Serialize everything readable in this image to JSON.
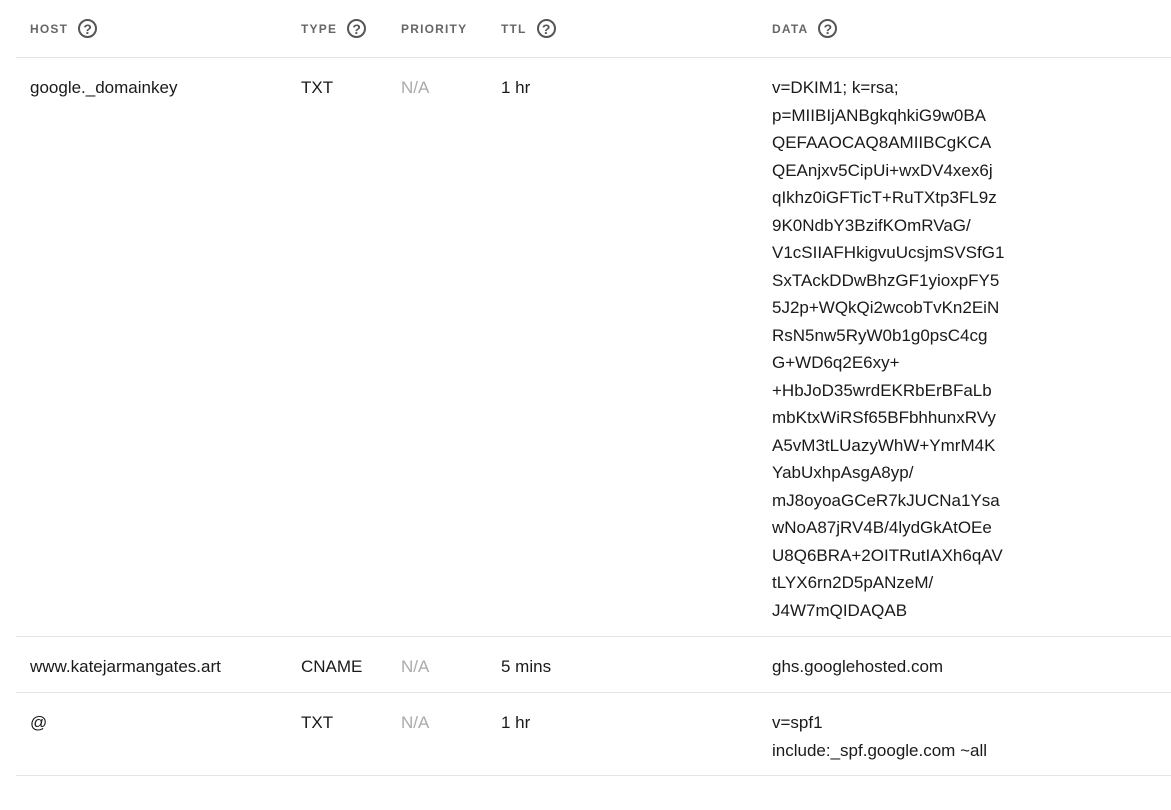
{
  "headers": {
    "host": "HOST",
    "type": "TYPE",
    "priority": "PRIORITY",
    "ttl": "TTL",
    "data": "DATA",
    "help_glyph": "?"
  },
  "records": [
    {
      "host": "google._domainkey",
      "type": "TXT",
      "priority": "N/A",
      "ttl": "1 hr",
      "data_lines": [
        "v=DKIM1; k=rsa;",
        "p=MIIBIjANBgkqhkiG9w0BA",
        "QEFAAOCAQ8AMIIBCgKCA",
        "QEAnjxv5CipUi+wxDV4xex6j",
        "qIkhz0iGFTicT+RuTXtp3FL9z",
        "9K0NdbY3BzifKOmRVaG/",
        "V1cSIIAFHkigvuUcsjmSVSfG1",
        "SxTAckDDwBhzGF1yioxpFY5",
        "5J2p+WQkQi2wcobTvKn2EiN",
        "RsN5nw5RyW0b1g0psC4cg",
        "G+WD6q2E6xy+",
        "+HbJoD35wrdEKRbErBFaLb",
        "mbKtxWiRSf65BFbhhunxRVy",
        "A5vM3tLUazyWhW+YmrM4K",
        "YabUxhpAsgA8yp/",
        "mJ8oyoaGCeR7kJUCNa1Ysa",
        "wNoA87jRV4B/4lydGkAtOEe",
        "U8Q6BRA+2OITRutIAXh6qAV",
        "tLYX6rn2D5pANzeM/",
        "J4W7mQIDAQAB"
      ]
    },
    {
      "host": "www.katejarmangates.art",
      "type": "CNAME",
      "priority": "N/A",
      "ttl": "5 mins",
      "data_lines": [
        "ghs.googlehosted.com"
      ]
    },
    {
      "host": "@",
      "type": "TXT",
      "priority": "N/A",
      "ttl": "1 hr",
      "data_lines": [
        "v=spf1",
        "include:_spf.google.com ~all"
      ]
    }
  ]
}
